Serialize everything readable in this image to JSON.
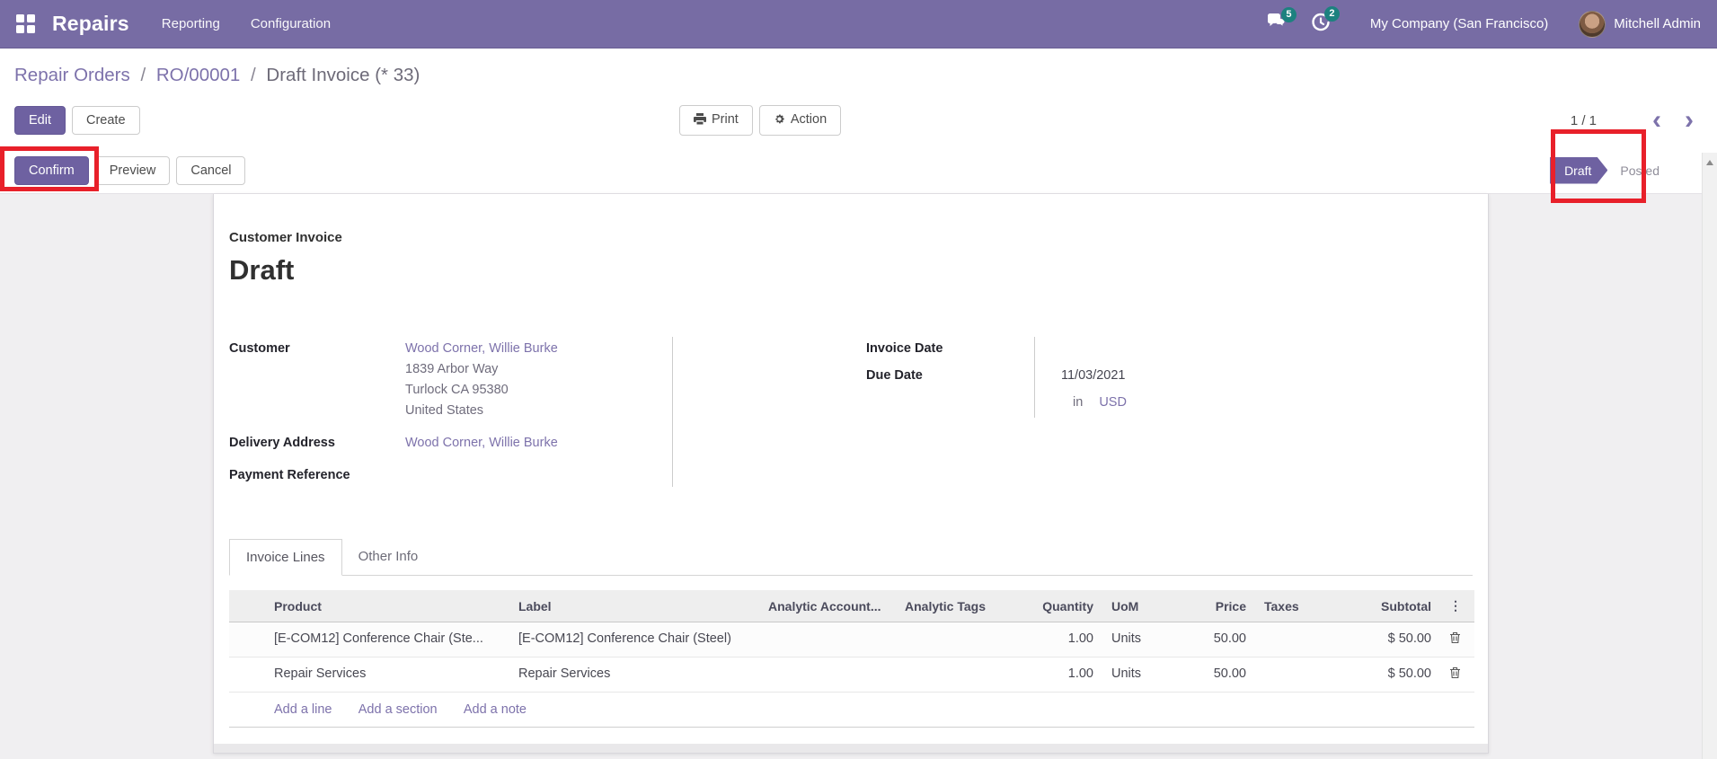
{
  "nav": {
    "app_name": "Repairs",
    "menus": [
      "Reporting",
      "Configuration"
    ],
    "messages_badge": "5",
    "activities_badge": "2",
    "company": "My Company (San Francisco)",
    "user": "Mitchell Admin"
  },
  "breadcrumb": {
    "items": [
      "Repair Orders",
      "RO/00001"
    ],
    "current": "Draft Invoice (* 33)",
    "separator": "/"
  },
  "actions": {
    "edit": "Edit",
    "create": "Create",
    "print": "Print",
    "action": "Action",
    "pager": "1 / 1"
  },
  "statusbar": {
    "confirm": "Confirm",
    "preview": "Preview",
    "cancel": "Cancel",
    "draft": "Draft",
    "posted": "Posted"
  },
  "invoice": {
    "type_label": "Customer Invoice",
    "state_title": "Draft",
    "fields": {
      "customer_label": "Customer",
      "customer_value": "Wood Corner, Willie Burke",
      "address_line1": "1839 Arbor Way",
      "address_line2": "Turlock CA 95380",
      "address_line3": "United States",
      "delivery_label": "Delivery Address",
      "delivery_value": "Wood Corner, Willie Burke",
      "payment_ref_label": "Payment Reference",
      "invoice_date_label": "Invoice Date",
      "due_date_label": "Due Date",
      "due_date_value": "11/03/2021",
      "currency_prefix": "in",
      "currency": "USD"
    },
    "tabs": [
      "Invoice Lines",
      "Other Info"
    ],
    "table": {
      "headers": [
        "Product",
        "Label",
        "Analytic Account...",
        "Analytic Tags",
        "Quantity",
        "UoM",
        "Price",
        "Taxes",
        "Subtotal"
      ],
      "rows": [
        {
          "product": "[E-COM12] Conference Chair (Ste...",
          "label": "[E-COM12] Conference Chair (Steel)",
          "analytic_account": "",
          "analytic_tags": "",
          "quantity": "1.00",
          "uom": "Units",
          "price": "50.00",
          "taxes": "",
          "subtotal": "$ 50.00"
        },
        {
          "product": "Repair Services",
          "label": "Repair Services",
          "analytic_account": "",
          "analytic_tags": "",
          "quantity": "1.00",
          "uom": "Units",
          "price": "50.00",
          "taxes": "",
          "subtotal": "$ 50.00"
        }
      ],
      "footer_links": [
        "Add a line",
        "Add a section",
        "Add a note"
      ]
    }
  },
  "colors": {
    "primary": "#6e61a1",
    "navbar": "#776ca4",
    "badge": "#1d817f",
    "annotation": "#e8202a",
    "link": "#7d72ab"
  }
}
